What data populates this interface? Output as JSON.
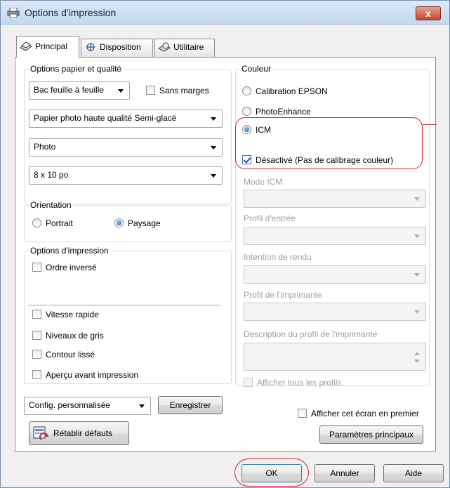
{
  "window": {
    "title": "Options d'impression",
    "close_label": "x"
  },
  "tabs": [
    {
      "label": "Principal",
      "active": true
    },
    {
      "label": "Disposition",
      "active": false
    },
    {
      "label": "Utilitaire",
      "active": false
    }
  ],
  "paper_quality": {
    "title": "Options papier et qualité",
    "source": "Bac feuille à feuille",
    "borderless_label": "Sans marges",
    "borderless_checked": false,
    "media_type": "Papier photo haute qualité Semi-glacé",
    "quality": "Photo",
    "size": "8 x 10 po"
  },
  "orientation": {
    "title": "Orientation",
    "portrait_label": "Portrait",
    "landscape_label": "Paysage",
    "selected": "Paysage"
  },
  "print_options": {
    "title": "Options d'impression",
    "reverse_order": "Ordre inversé",
    "high_speed": "Vitesse rapide",
    "grayscale": "Niveaux de gris",
    "smooth_edge": "Contour lissé",
    "preview": "Aperçu avant impression"
  },
  "custom_settings": {
    "selected": "Config. personnalisée",
    "save_label": "Enregistrer",
    "reset_label": "Rétablir défauts"
  },
  "color": {
    "title": "Couleur",
    "options": [
      "Calibration EPSON",
      "PhotoEnhance",
      "ICM"
    ],
    "selected": "ICM",
    "off_label": "Désactivé (Pas de calibrage couleur)",
    "off_checked": true,
    "icm_mode_label": "Mode ICM",
    "input_profile_label": "Profil d'entrée",
    "intent_label": "Intention de rendu",
    "printer_profile_label": "Profil de l'imprimante",
    "printer_profile_desc_label": "Description du profil de l'imprimante",
    "show_all_label": "Afficher tous les profils."
  },
  "footer": {
    "show_first_label": "Afficher cet écran en premier",
    "main_settings_label": "Paramètres principaux",
    "ok_label": "OK",
    "cancel_label": "Annuler",
    "help_label": "Aide"
  },
  "colors": {
    "highlight": "#d3222a",
    "accent": "#1b5fa8"
  }
}
